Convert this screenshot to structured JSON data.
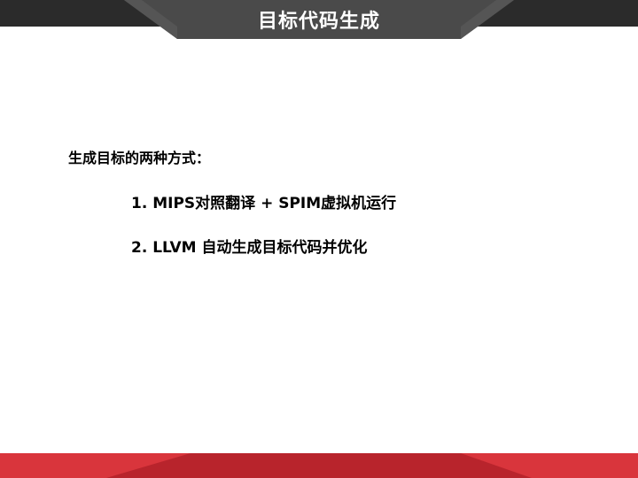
{
  "slide": {
    "title": "目标代码生成",
    "intro": "生成目标的两种方式：",
    "methods": [
      "1. MIPS对照翻译 + SPIM虚拟机运行",
      "2. LLVM 自动生成目标代码并优化"
    ]
  },
  "colors": {
    "header_dark": "#2b2b2b",
    "header_tab": "#4a4a4a",
    "header_accent": "#555555",
    "footer_red": "#d9353c",
    "footer_dark_red": "#b8242c",
    "text": "#000000",
    "title_text": "#ffffff"
  }
}
